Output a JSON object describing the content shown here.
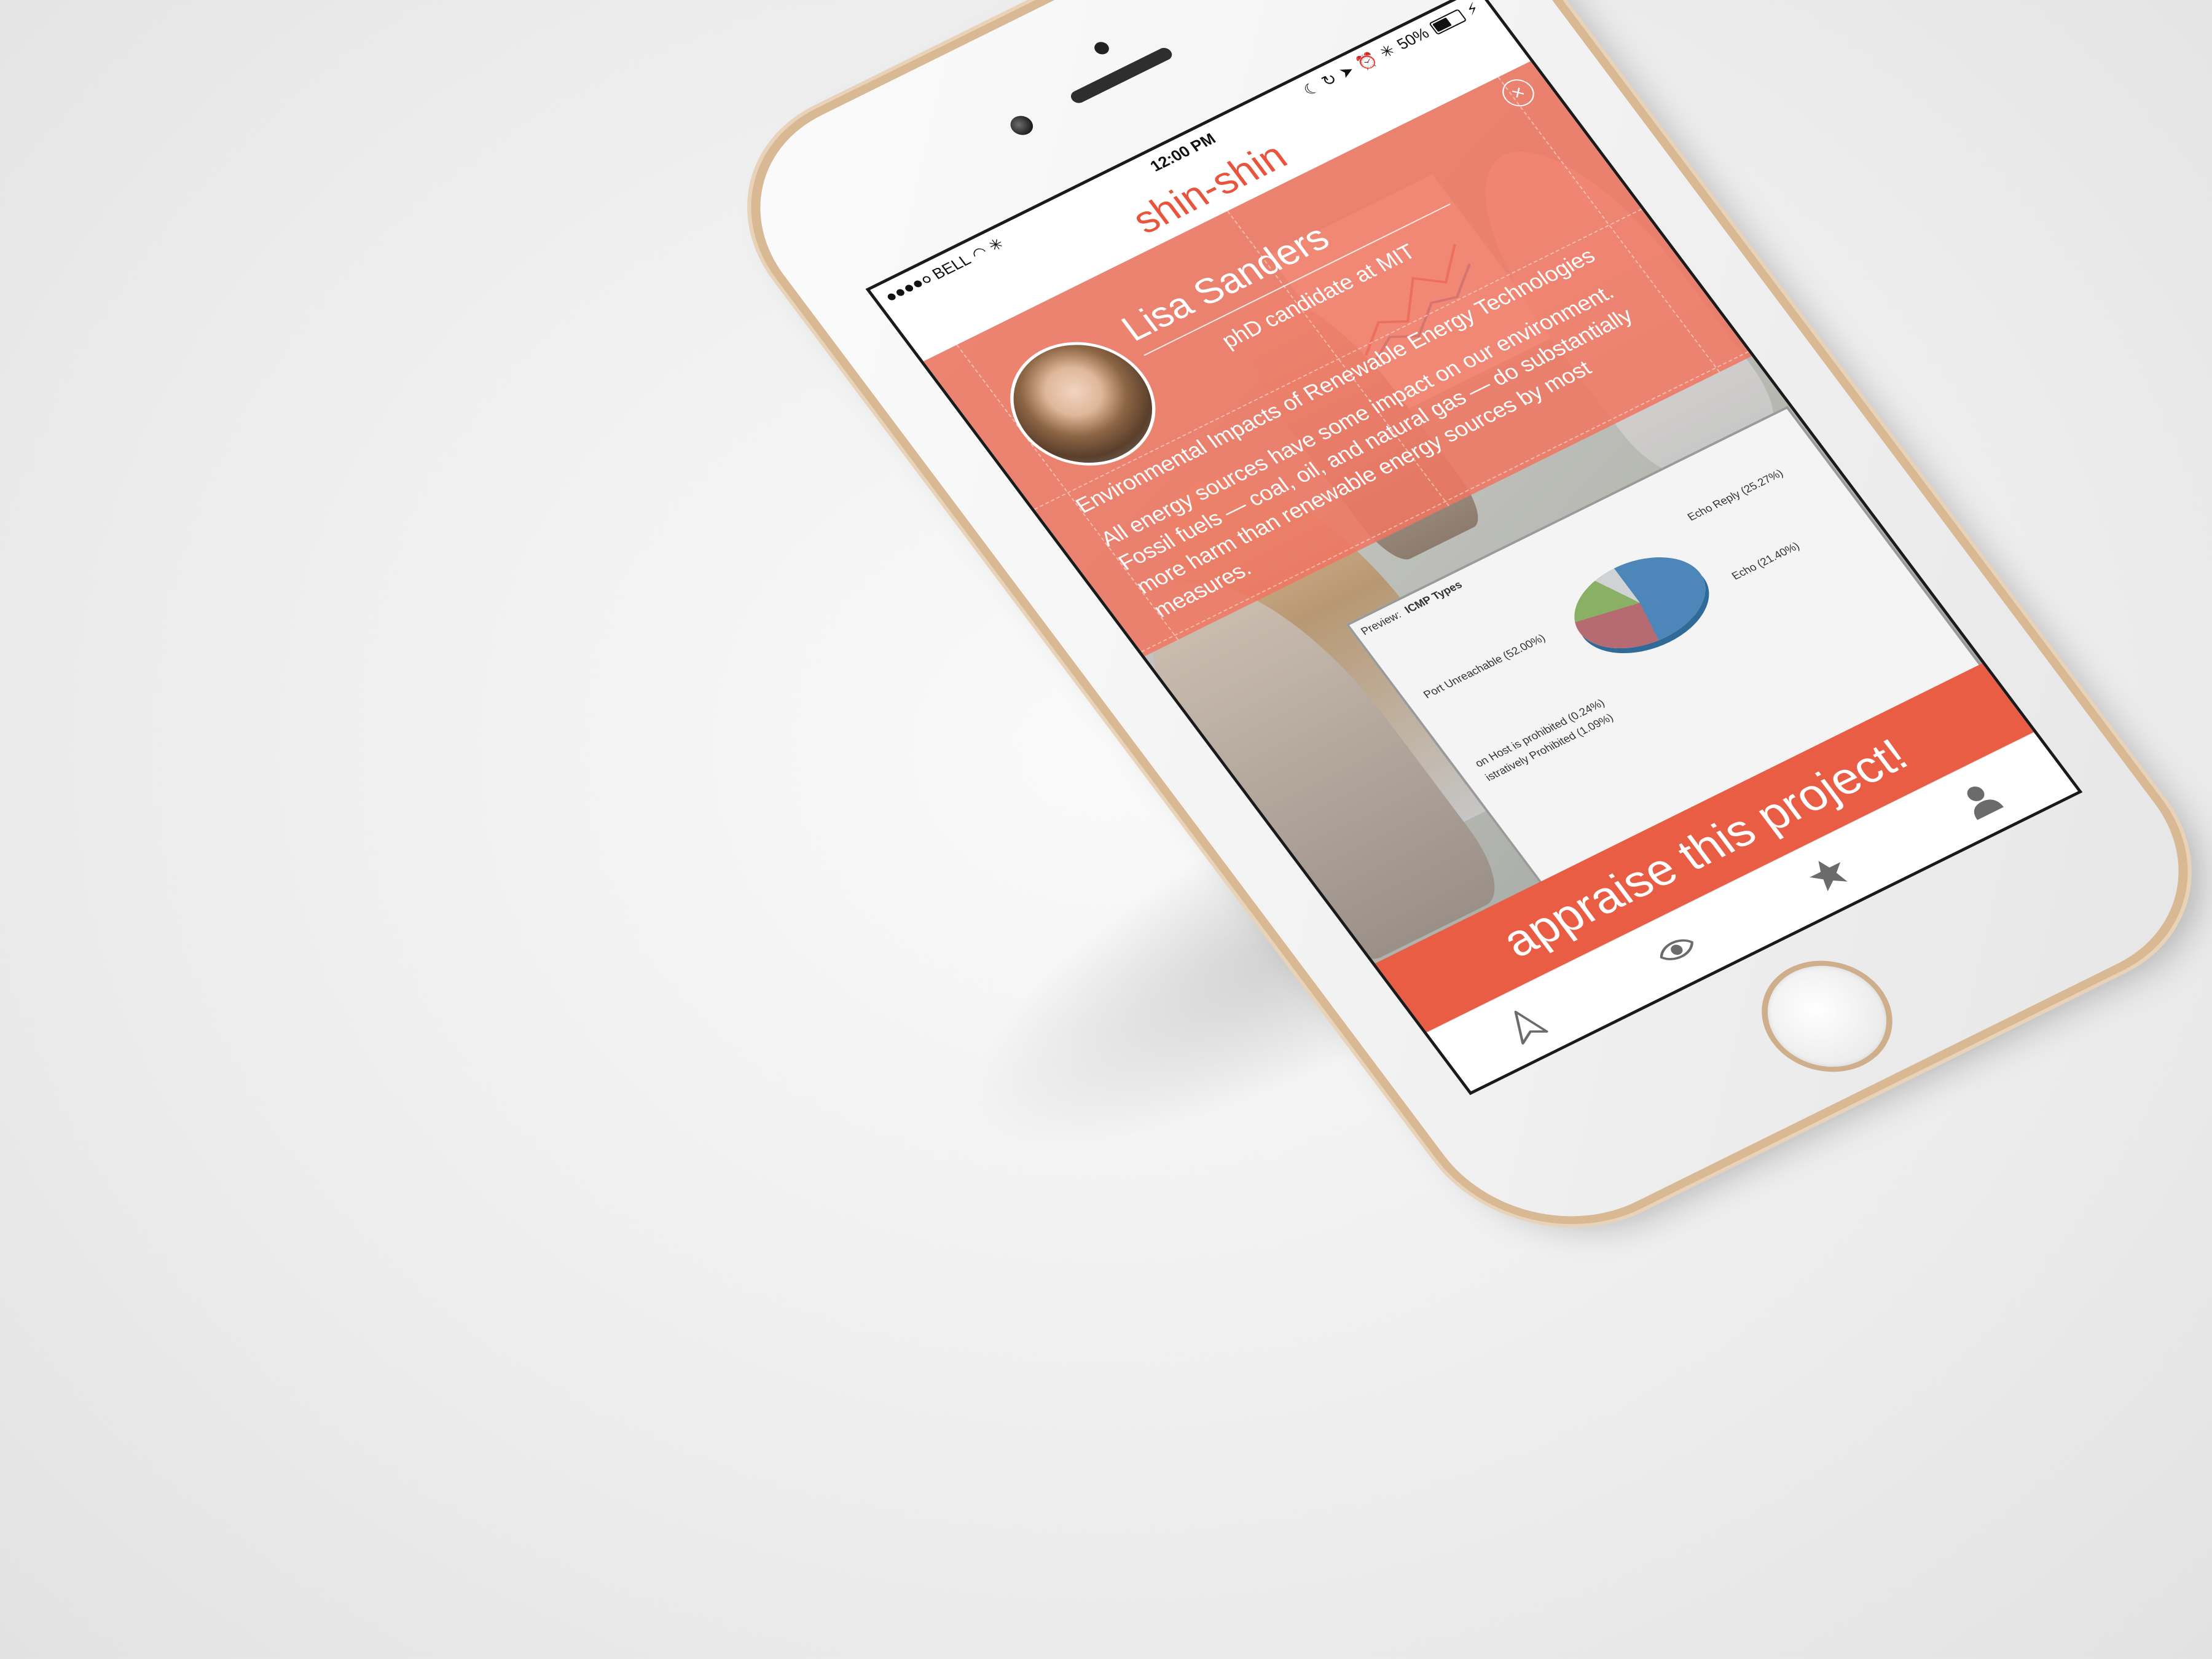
{
  "status_bar": {
    "carrier": "BELL",
    "time": "12:00 PM",
    "battery": "50%",
    "battery_level": 0.5
  },
  "app": {
    "brand": "shin-shin"
  },
  "profile": {
    "name": "Lisa Sanders",
    "role": "phD candidate at MIT"
  },
  "project": {
    "title": "Environmental Impacts of Renewable Energy Technologies",
    "description": "All energy sources have some impact on our environment. Fossil fuels — coal, oil, and natural gas — do substantially more harm than renewable energy sources by most measures."
  },
  "background_screen": {
    "panel_label": "Preview:",
    "chart_title": "ICMP Types",
    "labels": [
      "Echo Reply (25.27%)",
      "Echo (21.40%)",
      "Port Unreachable (52.00%)",
      "on Host is prohibited (0.24%)",
      "istratively Prohibited (1.09%)"
    ]
  },
  "cta": {
    "label": "appraise this project!"
  },
  "tabs": [
    {
      "icon": "send-icon"
    },
    {
      "icon": "eye-icon"
    },
    {
      "icon": "star-icon"
    },
    {
      "icon": "user-icon"
    }
  ],
  "colors": {
    "accent": "#ea5d45",
    "card_overlay": "#f07661",
    "brand_text": "#e8543c",
    "phone_trim": "#d9b894"
  }
}
